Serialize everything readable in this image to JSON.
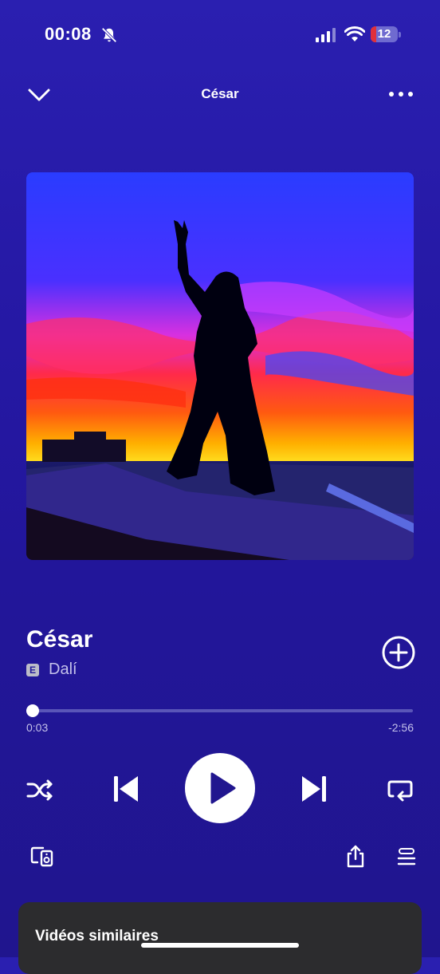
{
  "status_bar": {
    "time": "00:08",
    "battery": "12"
  },
  "header": {
    "title": "César"
  },
  "track": {
    "title": "César",
    "explicit_badge": "E",
    "artist": "Dalí"
  },
  "playback": {
    "elapsed": "0:03",
    "remaining": "-2:56",
    "progress_fraction": 0.017
  },
  "similar": {
    "title": "Vidéos similaires"
  },
  "colors": {
    "background": "#2518a4",
    "accent": "#ffffff",
    "muted_text": "#c4c1ea"
  }
}
